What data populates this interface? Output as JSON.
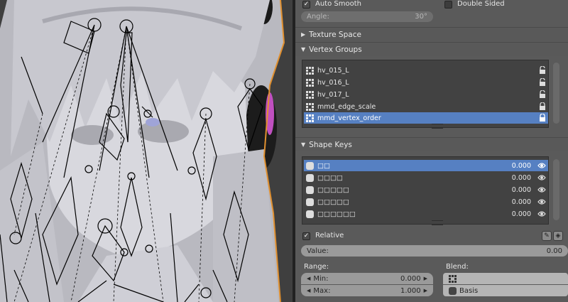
{
  "mesh_panel": {
    "auto_smooth": {
      "label": "Auto Smooth",
      "checked": true
    },
    "double_sided": {
      "label": "Double Sided",
      "checked": false
    },
    "angle": {
      "label": "Angle:",
      "value": "30°"
    }
  },
  "texture_space": {
    "label": "Texture Space",
    "expanded": false
  },
  "vertex_groups": {
    "label": "Vertex Groups",
    "expanded": true,
    "items": [
      {
        "name": "hv_015_L",
        "selected": false
      },
      {
        "name": "hv_016_L",
        "selected": false
      },
      {
        "name": "hv_017_L",
        "selected": false
      },
      {
        "name": "mmd_edge_scale",
        "selected": false
      },
      {
        "name": "mmd_vertex_order",
        "selected": true
      }
    ]
  },
  "shape_keys": {
    "label": "Shape Keys",
    "expanded": true,
    "items": [
      {
        "name": "□□",
        "value": "0.000",
        "selected": true
      },
      {
        "name": "□□□□",
        "value": "0.000",
        "selected": false
      },
      {
        "name": "□□□□□",
        "value": "0.000",
        "selected": false
      },
      {
        "name": "□□□□□",
        "value": "0.000",
        "selected": false
      },
      {
        "name": "□□□□□□",
        "value": "0.000",
        "selected": false
      }
    ],
    "relative": {
      "label": "Relative",
      "checked": true
    },
    "value_field": {
      "label": "Value:",
      "value": "0.00"
    },
    "range": {
      "label": "Range:",
      "min_label": "Min:",
      "min_value": "0.000",
      "max_label": "Max:",
      "max_value": "1.000"
    },
    "blend": {
      "label": "Blend:",
      "vertex_group": "",
      "basis": "Basis"
    }
  },
  "colors": {
    "selection": "#5680c2",
    "panel": "#5a5a5a",
    "list_bg": "#424242",
    "field": "#9a9a9a"
  }
}
